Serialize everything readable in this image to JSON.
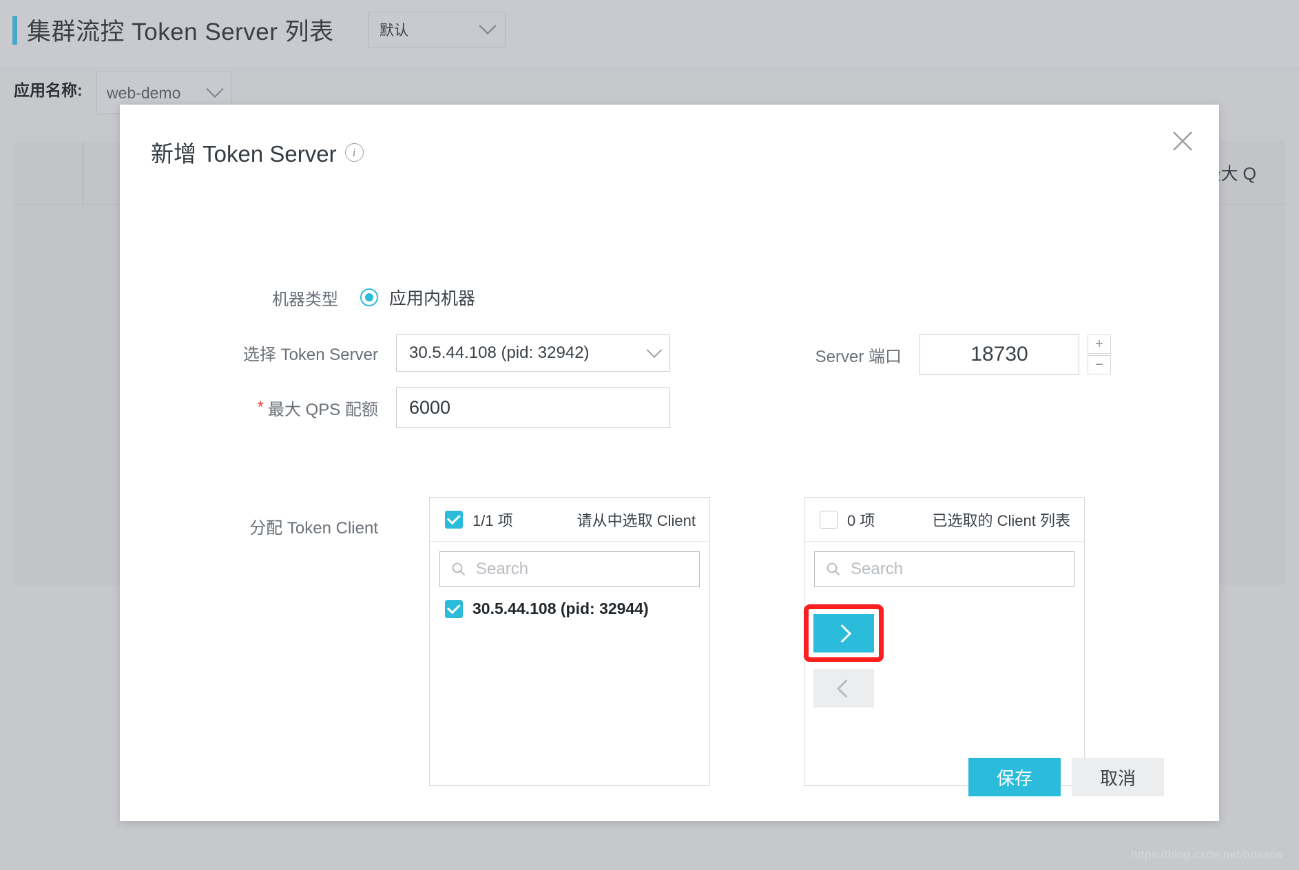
{
  "background": {
    "page_title": "集群流控 Token Server 列表",
    "scope_select": {
      "value": "默认",
      "icon": "chevron-down-icon"
    },
    "app_filter": {
      "label": "应用名称:",
      "select_value": "web-demo",
      "icon": "chevron-down-icon"
    },
    "table": {
      "visible_column_header": "最大 Q"
    },
    "watermark": "https://blog.csdn.net/hosaos"
  },
  "dialog": {
    "title": "新增 Token Server",
    "title_info_icon": "info-circle-icon",
    "close_icon": "close-icon",
    "fields": {
      "machine_type": {
        "label": "机器类型",
        "radio_selected": true,
        "radio_label": "应用内机器"
      },
      "token_server": {
        "label": "选择 Token Server",
        "value": "30.5.44.108 (pid: 32942)",
        "icon": "chevron-down-icon"
      },
      "server_port": {
        "label": "Server 端口",
        "value": "18730",
        "increment_label": "+",
        "decrement_label": "−"
      },
      "max_qps": {
        "label": "最大 QPS 配额",
        "required_marker": "*",
        "value": "6000"
      },
      "assign_clients": {
        "label": "分配 Token Client"
      }
    },
    "transfer": {
      "source": {
        "checkbox_checked": true,
        "count_text": "1/1 项",
        "title": "请从中选取 Client",
        "search_placeholder": "Search",
        "search_value": "",
        "search_icon": "search-icon",
        "items": [
          {
            "label": "30.5.44.108 (pid: 32944)",
            "checked": true
          }
        ]
      },
      "target": {
        "checkbox_checked": false,
        "count_text": "0 项",
        "title": "已选取的 Client 列表",
        "search_placeholder": "Search",
        "search_value": "",
        "search_icon": "search-icon",
        "items": []
      },
      "move_right_icon": "chevron-right-icon",
      "move_left_icon": "chevron-left-icon",
      "move_right_enabled": true,
      "move_left_enabled": false,
      "highlight_color": "#fc1f1f"
    },
    "footer": {
      "save_label": "保存",
      "cancel_label": "取消"
    }
  },
  "colors": {
    "accent": "#2bbcdb",
    "title_accent_bar": "#4aa8c8",
    "required_star": "#e8412f",
    "highlight": "#fc1f1f",
    "page_background": "#c6c8cc"
  }
}
